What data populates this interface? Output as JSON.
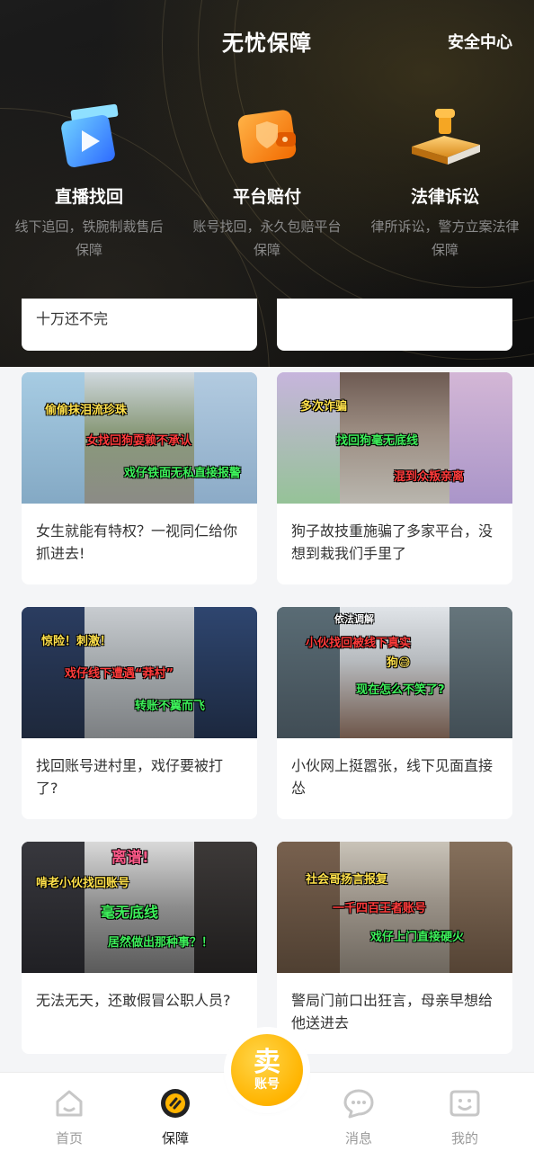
{
  "header": {
    "title": "无忧保障",
    "right_link": "安全中心",
    "features": [
      {
        "icon": "video-play-icon",
        "title": "直播找回",
        "desc": "线下追回，铁腕制裁售后保障"
      },
      {
        "icon": "wallet-shield-icon",
        "title": "平台赔付",
        "desc": "账号找回，永久包赔平台保障"
      },
      {
        "icon": "gavel-book-icon",
        "title": "法律诉讼",
        "desc": "律所诉讼，警方立案法律保障"
      }
    ]
  },
  "partial_cards": [
    {
      "title": "十万还不完"
    },
    {
      "title": ""
    }
  ],
  "cards": [
    {
      "title": "女生就能有特权？一视同仁给你抓进去!",
      "captions": [
        {
          "text": "偷偷抹泪流珍珠",
          "color": "yellow"
        },
        {
          "text": "女找回狗耍赖不承认",
          "color": "red"
        },
        {
          "text": "戏仔铁面无私直接报警",
          "color": "green"
        }
      ]
    },
    {
      "title": "狗子故技重施骗了多家平台，没想到栽我们手里了",
      "captions": [
        {
          "text": "多次诈骗",
          "color": "yellow"
        },
        {
          "text": "找回狗毫无底线",
          "color": "green"
        },
        {
          "text": "混到众叛亲离",
          "color": "red"
        }
      ]
    },
    {
      "title": "找回账号进村里，戏仔要被打了?",
      "captions": [
        {
          "text": "惊险！刺激！",
          "color": "yellow"
        },
        {
          "text": "戏仔线下遭遇“莽村”",
          "color": "red"
        },
        {
          "text": "转账不翼而飞",
          "color": "green"
        }
      ]
    },
    {
      "title": "小伙网上挺嚣张，线下见面直接怂",
      "captions": [
        {
          "text": "依法调解",
          "color": "white"
        },
        {
          "text": "小伙找回被线下真实",
          "color": "red"
        },
        {
          "text": "狗😅",
          "color": "yellow"
        },
        {
          "text": "现在怎么不笑了?",
          "color": "green"
        }
      ]
    },
    {
      "title": "无法无天，还敢假冒公职人员?",
      "captions": [
        {
          "text": "离谱!",
          "color": "pink"
        },
        {
          "text": "啃老小伙找回账号",
          "color": "yellow"
        },
        {
          "text": "毫无底线",
          "color": "green"
        },
        {
          "text": "居然做出那种事？！",
          "color": "green"
        }
      ]
    },
    {
      "title": "警局门前口出狂言，母亲早想给他送进去",
      "captions": [
        {
          "text": "社会哥扬言报复",
          "color": "yellow"
        },
        {
          "text": "一千四百王者账号",
          "color": "red"
        },
        {
          "text": "戏仔上门直接硬火",
          "color": "green"
        }
      ]
    }
  ],
  "tabbar": {
    "items": [
      {
        "label": "首页",
        "icon": "home-icon",
        "active": false
      },
      {
        "label": "保障",
        "icon": "shield-icon",
        "active": true
      },
      {
        "label": "消息",
        "icon": "chat-bubble-icon",
        "active": false
      },
      {
        "label": "我的",
        "icon": "smile-face-icon",
        "active": false
      }
    ],
    "sell": {
      "big": "卖",
      "small": "账号"
    }
  },
  "colors": {
    "accent": "#ffb400",
    "header_bg": "#141414"
  }
}
